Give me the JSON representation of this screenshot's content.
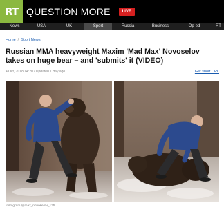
{
  "header": {
    "logo_text": "RT",
    "site_name": "QUESTION MORE",
    "live_label": "LIVE",
    "logo_color": "#8bb840",
    "live_color": "#d62020"
  },
  "nav": {
    "items": [
      "News",
      "USA",
      "UK",
      "Sport",
      "Russia",
      "Business",
      "Op-ed",
      "RT"
    ],
    "active": "Sport"
  },
  "breadcrumb": {
    "home": "Home",
    "section": "Sport News"
  },
  "article": {
    "headline": "Russian MMA heavyweight Maxim 'Mad Max' Novoselov takes on huge bear – and 'submits' it (VIDEO)",
    "meta": "4 Oct, 2018 14:20 / Updated 1 day ago",
    "short_url_label": "Get short URL",
    "caption": "Instagram @max_novoselov_135"
  }
}
